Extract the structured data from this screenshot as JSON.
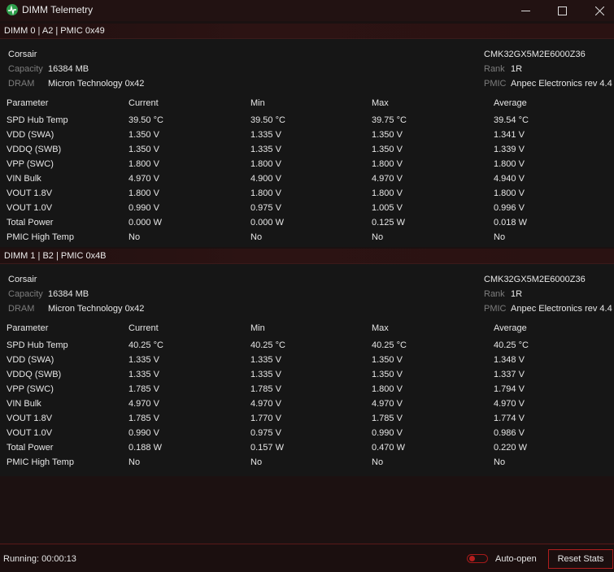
{
  "window": {
    "title": "DIMM Telemetry"
  },
  "dimms": [
    {
      "header": "DIMM 0 | A2 | PMIC 0x49",
      "vendor": "Corsair",
      "part_number": "CMK32GX5M2E6000Z36",
      "capacity_label": "Capacity",
      "capacity_value": "16384 MB",
      "rank_label": "Rank",
      "rank_value": "1R",
      "dram_label": "DRAM",
      "dram_value": "Micron Technology 0x42",
      "pmic_label": "PMIC",
      "pmic_value": "Anpec Electronics rev 4.4",
      "columns": [
        "Parameter",
        "Current",
        "Min",
        "Max",
        "Average"
      ],
      "rows": [
        [
          "SPD Hub Temp",
          "39.50 °C",
          "39.50 °C",
          "39.75 °C",
          "39.54 °C"
        ],
        [
          "VDD (SWA)",
          "1.350 V",
          "1.335 V",
          "1.350 V",
          "1.341 V"
        ],
        [
          "VDDQ (SWB)",
          "1.350 V",
          "1.335 V",
          "1.350 V",
          "1.339 V"
        ],
        [
          "VPP (SWC)",
          "1.800 V",
          "1.800 V",
          "1.800 V",
          "1.800 V"
        ],
        [
          "VIN Bulk",
          "4.970 V",
          "4.900 V",
          "4.970 V",
          "4.940 V"
        ],
        [
          "VOUT 1.8V",
          "1.800 V",
          "1.800 V",
          "1.800 V",
          "1.800 V"
        ],
        [
          "VOUT 1.0V",
          "0.990 V",
          "0.975 V",
          "1.005 V",
          "0.996 V"
        ],
        [
          "Total Power",
          "0.000 W",
          "0.000 W",
          "0.125 W",
          "0.018 W"
        ],
        [
          "PMIC High Temp",
          "No",
          "No",
          "No",
          "No"
        ]
      ]
    },
    {
      "header": "DIMM 1 | B2 | PMIC 0x4B",
      "vendor": "Corsair",
      "part_number": "CMK32GX5M2E6000Z36",
      "capacity_label": "Capacity",
      "capacity_value": "16384 MB",
      "rank_label": "Rank",
      "rank_value": "1R",
      "dram_label": "DRAM",
      "dram_value": "Micron Technology 0x42",
      "pmic_label": "PMIC",
      "pmic_value": "Anpec Electronics rev 4.4",
      "columns": [
        "Parameter",
        "Current",
        "Min",
        "Max",
        "Average"
      ],
      "rows": [
        [
          "SPD Hub Temp",
          "40.25 °C",
          "40.25 °C",
          "40.25 °C",
          "40.25 °C"
        ],
        [
          "VDD (SWA)",
          "1.335 V",
          "1.335 V",
          "1.350 V",
          "1.348 V"
        ],
        [
          "VDDQ (SWB)",
          "1.335 V",
          "1.335 V",
          "1.350 V",
          "1.337 V"
        ],
        [
          "VPP (SWC)",
          "1.785 V",
          "1.785 V",
          "1.800 V",
          "1.794 V"
        ],
        [
          "VIN Bulk",
          "4.970 V",
          "4.970 V",
          "4.970 V",
          "4.970 V"
        ],
        [
          "VOUT 1.8V",
          "1.785 V",
          "1.770 V",
          "1.785 V",
          "1.774 V"
        ],
        [
          "VOUT 1.0V",
          "0.990 V",
          "0.975 V",
          "0.990 V",
          "0.986 V"
        ],
        [
          "Total Power",
          "0.188 W",
          "0.157 W",
          "0.470 W",
          "0.220 W"
        ],
        [
          "PMIC High Temp",
          "No",
          "No",
          "No",
          "No"
        ]
      ]
    }
  ],
  "status": {
    "running_text": "Running: 00:00:13",
    "auto_open_label": "Auto-open",
    "auto_open_enabled": false,
    "reset_label": "Reset Stats"
  },
  "colors": {
    "accent": "#b01e1e",
    "app_icon": "#2e9e4b",
    "label": "#7d7d7d"
  }
}
